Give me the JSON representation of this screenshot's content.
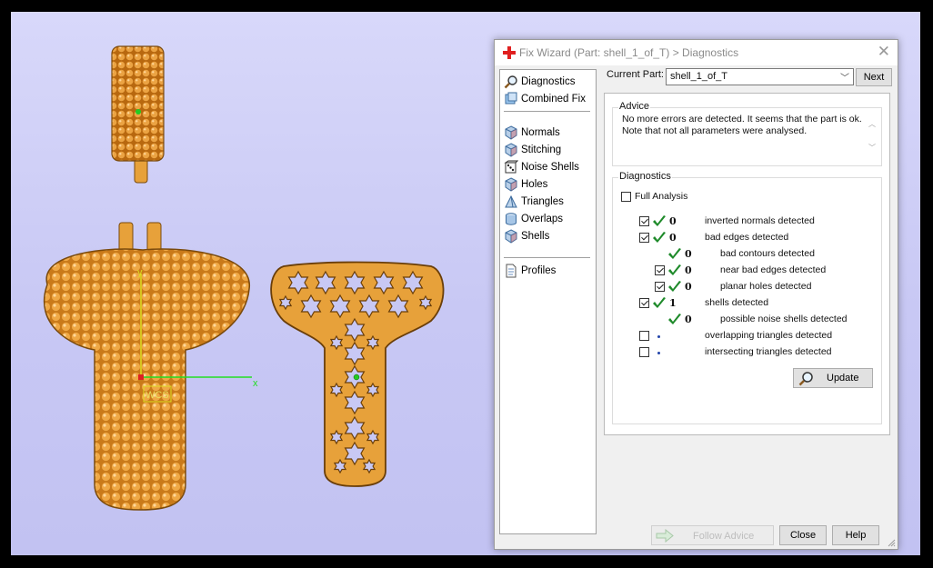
{
  "dialog": {
    "title": "Fix Wizard (Part: shell_1_of_T) > Diagnostics",
    "current_part_label": "Current Part:",
    "current_part_value": "shell_1_of_T",
    "next_label": "Next",
    "nav": {
      "top": [
        {
          "label": "Diagnostics",
          "icon": "magnifier-icon"
        },
        {
          "label": "Combined Fix",
          "icon": "combined-fix-icon"
        }
      ],
      "tools": [
        {
          "label": "Normals",
          "icon": "cube-icon"
        },
        {
          "label": "Stitching",
          "icon": "cube-icon"
        },
        {
          "label": "Noise Shells",
          "icon": "dice-icon"
        },
        {
          "label": "Holes",
          "icon": "cube-icon"
        },
        {
          "label": "Triangles",
          "icon": "triangle-prism-icon"
        },
        {
          "label": "Overlaps",
          "icon": "cylinder-icon"
        },
        {
          "label": "Shells",
          "icon": "cube-icon"
        }
      ],
      "bottom": [
        {
          "label": "Profiles",
          "icon": "document-icon"
        }
      ]
    },
    "advice": {
      "title": "Advice",
      "line1": "No more errors are detected. It seems that the part is ok.",
      "line2": "Note that not all parameters were analysed."
    },
    "diagnostics": {
      "title": "Diagnostics",
      "full_analysis_label": "Full Analysis",
      "full_analysis_checked": false,
      "rows": [
        {
          "checked": true,
          "has_checkbox": true,
          "status": "ok",
          "count": "0",
          "label": "inverted normals detected"
        },
        {
          "checked": true,
          "has_checkbox": true,
          "status": "ok",
          "count": "0",
          "label": "bad edges detected"
        },
        {
          "checked": false,
          "has_checkbox": false,
          "status": "ok",
          "count": "0",
          "label": "bad contours detected"
        },
        {
          "checked": true,
          "has_checkbox": true,
          "status": "ok",
          "count": "0",
          "label": "near bad edges detected"
        },
        {
          "checked": true,
          "has_checkbox": true,
          "status": "ok",
          "count": "0",
          "label": "planar holes detected"
        },
        {
          "checked": true,
          "has_checkbox": true,
          "status": "ok",
          "count": "1",
          "label": "shells detected"
        },
        {
          "checked": false,
          "has_checkbox": false,
          "status": "ok",
          "count": "0",
          "label": "possible noise shells detected"
        },
        {
          "checked": false,
          "has_checkbox": true,
          "status": "not-run",
          "count": "",
          "label": "overlapping triangles detected"
        },
        {
          "checked": false,
          "has_checkbox": true,
          "status": "not-run",
          "count": "",
          "label": "intersecting triangles detected"
        }
      ],
      "update_label": "Update"
    },
    "follow_advice_label": "Follow Advice",
    "close_label": "Close",
    "help_label": "Help"
  },
  "viewport": {
    "wcs_label": "WCS",
    "axis_x": "x",
    "axis_y": "y"
  },
  "colors": {
    "background": "#c8c8f4",
    "part_orange": "#e7a13a",
    "check_green": "#1e8a2a",
    "axis_green": "#22dd22",
    "axis_yellow": "#dddd22"
  }
}
